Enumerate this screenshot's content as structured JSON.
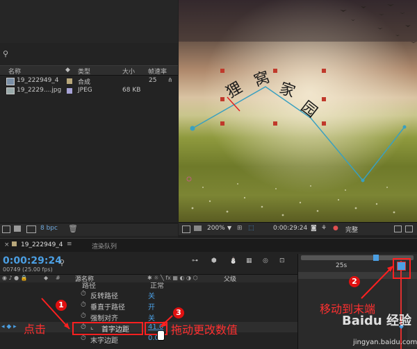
{
  "project": {
    "columns": {
      "name": "名称",
      "type": "类型",
      "size": "大小",
      "fps": "帧速率"
    },
    "items": [
      {
        "name": "19_222949_4",
        "type": "合成",
        "size": "",
        "fps": "25"
      },
      {
        "name": "19_2229....jpg",
        "type": "JPEG",
        "size": "68 KB",
        "fps": ""
      }
    ],
    "bpc": "8 bpc"
  },
  "viewer": {
    "zoom": "200%",
    "timecode": "0:00:29:24",
    "resolution": "完整",
    "text_chars": [
      "狸",
      "窝",
      "家",
      "园"
    ],
    "text_color": "#1a1a1a",
    "path_color": "#39a0c0"
  },
  "timeline": {
    "tab_comp": "19_222949_4",
    "tab_render": "渲染队列",
    "time": "0:00:29:24",
    "frames": "00749 (25.00 fps)",
    "ruler_label": "25s",
    "header": {
      "source_name": "源名称",
      "parent": "父级",
      "mode": "正常"
    },
    "properties": [
      {
        "name": "路径",
        "value": ""
      },
      {
        "name": "反转路径",
        "value": "关"
      },
      {
        "name": "垂直于路径",
        "value": "开"
      },
      {
        "name": "强制对齐",
        "value": "关"
      },
      {
        "name": "首字边距",
        "value": "41.0"
      },
      {
        "name": "末字边距",
        "value": "0.0"
      }
    ]
  },
  "annotations": {
    "click": "点击",
    "drag": "拖动更改数值",
    "move_end": "移动到末端",
    "num1": "1",
    "num2": "2",
    "num3": "3",
    "watermark": "Baidu 经验",
    "url": "jingyan.baidu.com",
    "color": "#ff2020"
  }
}
